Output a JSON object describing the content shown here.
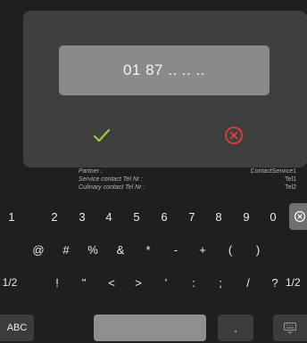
{
  "dialog": {
    "value": "01 87 .. .. ..",
    "confirm_icon": "checkmark-icon",
    "cancel_icon": "circle-x-icon",
    "confirm_color": "#9ccc3c",
    "cancel_color": "#e63b3b"
  },
  "info": [
    {
      "label": "Partner :",
      "value": "ContactService1"
    },
    {
      "label": "Service contact Tel Nr :",
      "value": "Tel1"
    },
    {
      "label": "Culinary contact Tel Nr :",
      "value": "Tel2"
    }
  ],
  "keyboard": {
    "row1": [
      "1",
      "2",
      "3",
      "4",
      "5",
      "6",
      "7",
      "8",
      "9",
      "0"
    ],
    "row2": [
      "@",
      "#",
      "%",
      "&",
      "*",
      "-",
      "+",
      "(",
      ")"
    ],
    "row3": [
      "1/2",
      "!",
      "\"",
      "<",
      ">",
      "'",
      ":",
      ";",
      "/",
      "?",
      "1/2"
    ],
    "backspace_icon": "backspace-icon",
    "abc_label": "ABC",
    "period_label": ".",
    "hide_icon": "keyboard-hide-icon"
  }
}
